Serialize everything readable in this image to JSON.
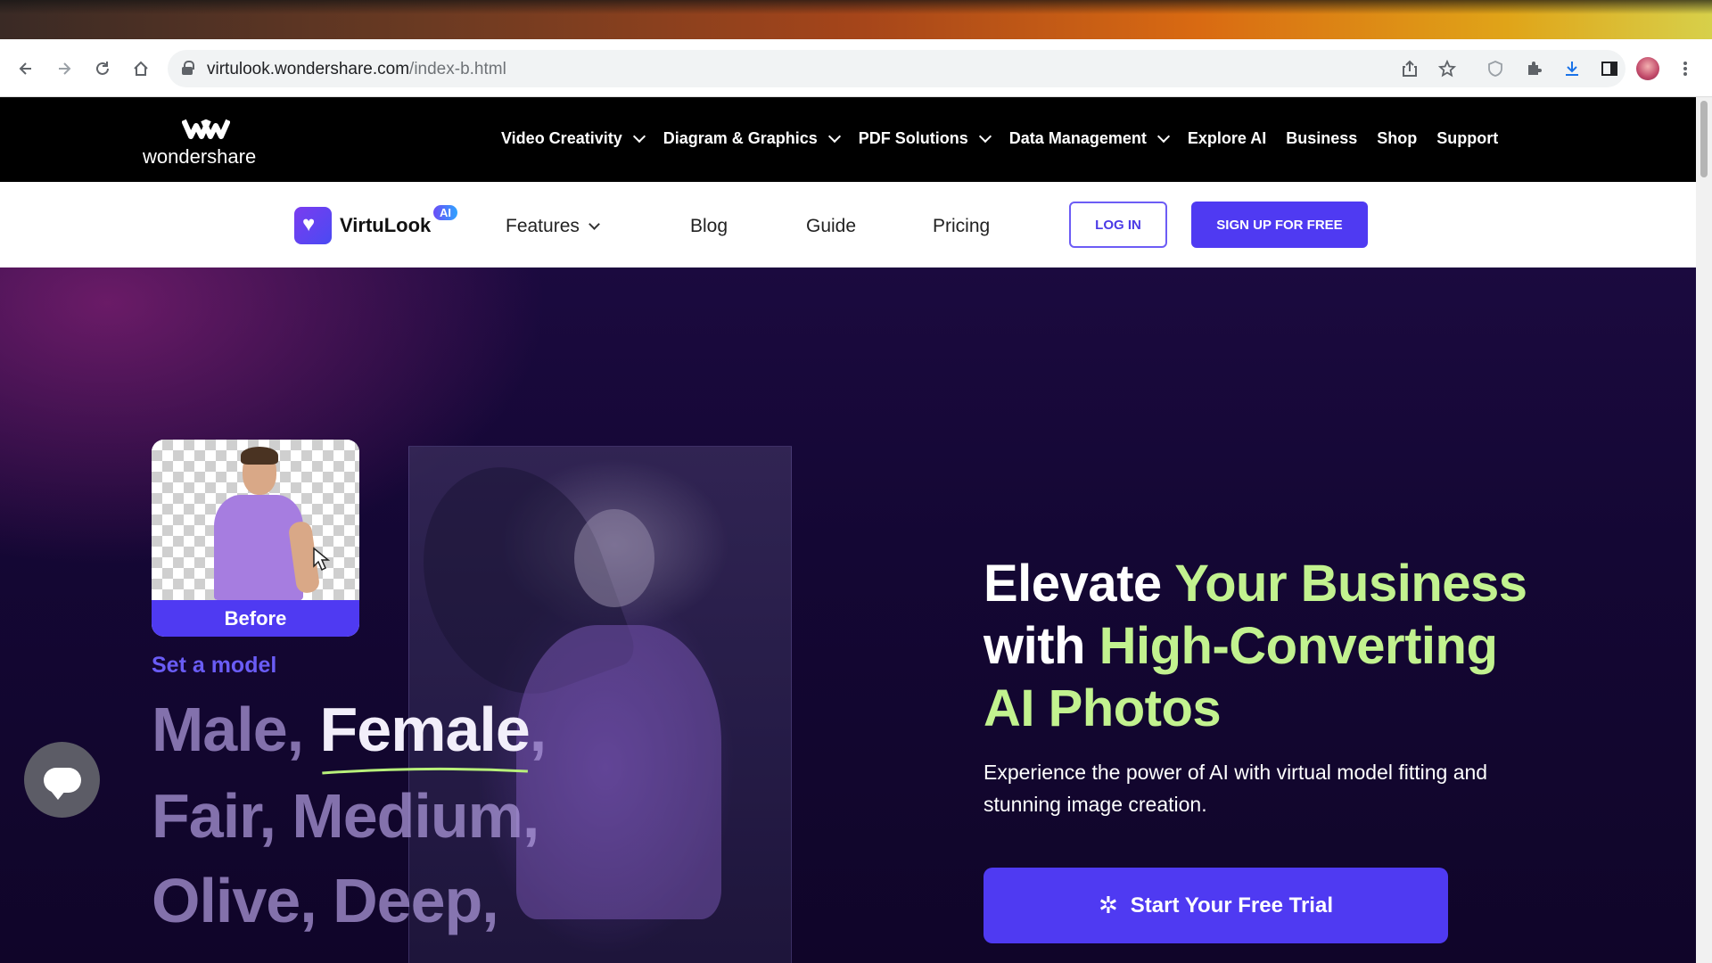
{
  "browser": {
    "url_host": "virtulook.wondershare.com",
    "url_path": "/index-b.html",
    "nav_icons": [
      "back-icon",
      "forward-icon",
      "reload-icon",
      "home-icon"
    ],
    "toolbar_icons": [
      "share-icon",
      "star-icon",
      "shield-icon",
      "extensions-icon",
      "download-icon",
      "sidebar-icon",
      "profile-avatar",
      "menu-icon"
    ]
  },
  "ws_header": {
    "logo_text": "wondershare",
    "nav": [
      {
        "label": "Video Creativity",
        "has_dropdown": true
      },
      {
        "label": "Diagram & Graphics",
        "has_dropdown": true
      },
      {
        "label": "PDF Solutions",
        "has_dropdown": true
      },
      {
        "label": "Data Management",
        "has_dropdown": true
      },
      {
        "label": "Explore AI",
        "has_dropdown": false
      },
      {
        "label": "Business",
        "has_dropdown": false
      },
      {
        "label": "Shop",
        "has_dropdown": false
      },
      {
        "label": "Support",
        "has_dropdown": false
      }
    ]
  },
  "sub_nav": {
    "brand": "VirtuLook",
    "badge": "AI",
    "features": "Features",
    "blog": "Blog",
    "guide": "Guide",
    "pricing": "Pricing",
    "login": "LOG IN",
    "signup": "SIGN UP FOR FREE"
  },
  "hero": {
    "before_label": "Before",
    "set_model": "Set a model",
    "line1_a": "Male, ",
    "line1_b": "Female",
    "line1_c": ",",
    "line2": "Fair, Medium,",
    "line3": "Olive, Deep,",
    "headline_1": "Elevate ",
    "headline_2": "Your Business",
    "headline_3": "with ",
    "headline_4": "High-Converting",
    "headline_5": "AI Photos",
    "subhead": "Experience the power of AI with virtual model fitting and stunning image creation.",
    "cta": "Start Your Free Trial"
  },
  "colors": {
    "accent": "#4f3af2",
    "headline_green": "#c2f28f",
    "hero_bg": "#140734"
  }
}
